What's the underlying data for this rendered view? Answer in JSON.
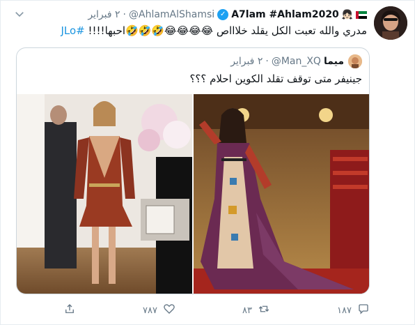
{
  "tweet": {
    "display_name": "A7lam #Ahlam2020",
    "handle": "@AhlamAlShamsi",
    "separator": "·",
    "date": "٢ فبراير",
    "text_main": "مدري والله تعبت الكل يقلد خلاااص 😂😂😂😂🤣🤣🤣احبها!!!!",
    "hashtag": "#JLo",
    "emoji_badge": "👧🏻"
  },
  "quoted": {
    "display_name": "ميما",
    "handle": "@Man_XQ",
    "separator": "·",
    "date": "٢ فبراير",
    "text": "جينيفر متى توقف تقلد الكوين احلام ؟؟؟"
  },
  "actions": {
    "reply_count": "١٨٧",
    "retweet_count": "٨٣",
    "like_count": "٧٨٧"
  },
  "colors": {
    "accent": "#1da1f2",
    "muted": "#657786",
    "border": "#e6ecf0"
  }
}
